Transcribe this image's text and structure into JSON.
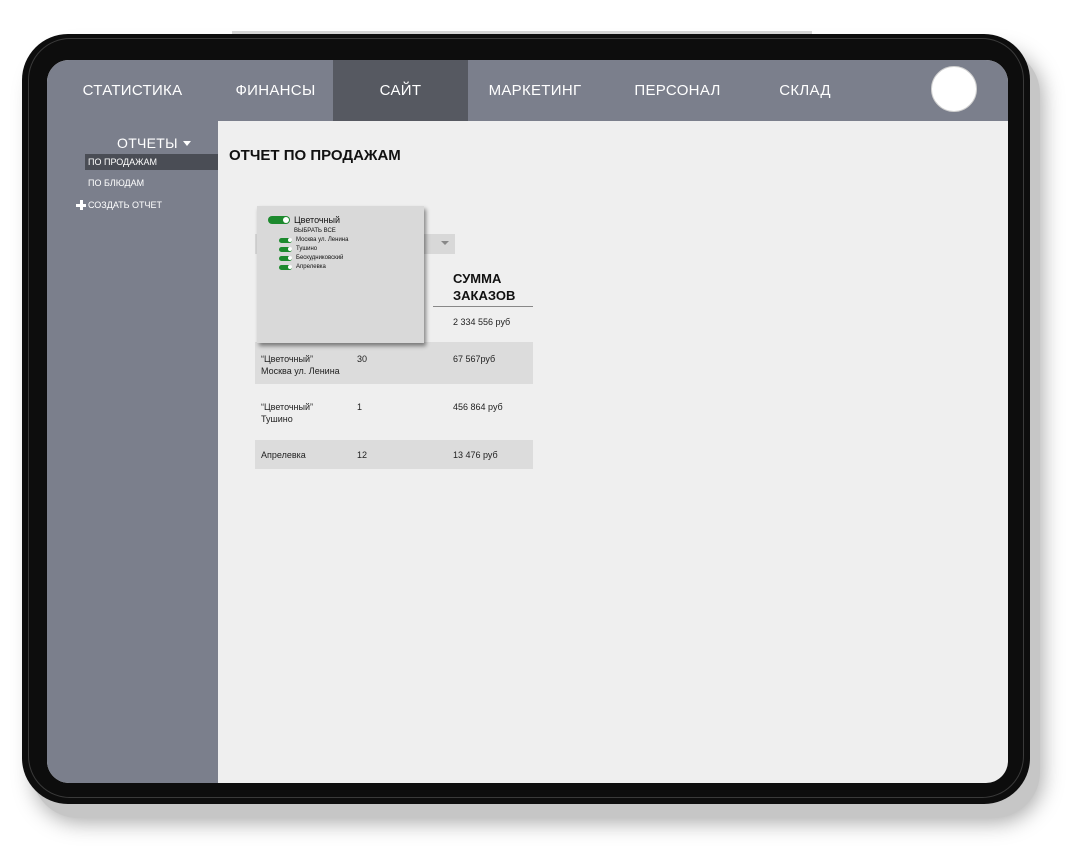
{
  "nav": {
    "items": [
      {
        "label": "СТАТИСТИКА",
        "active": false
      },
      {
        "label": "ФИНАНСЫ",
        "active": false
      },
      {
        "label": "САЙТ",
        "active": true
      },
      {
        "label": "МАРКЕТИНГ",
        "active": false
      },
      {
        "label": "ПЕРСОНАЛ",
        "active": false
      },
      {
        "label": "СКЛАД",
        "active": false
      }
    ]
  },
  "sidebar": {
    "heading": "ОТЧЕТЫ",
    "items": [
      {
        "label": "ПО ПРОДАЖАМ",
        "selected": true
      },
      {
        "label": "ПО БЛЮДАМ",
        "selected": false
      }
    ],
    "create_label": "СОЗДАТЬ ОТЧЕТ"
  },
  "main": {
    "title": "ОТЧЕТ ПО ПРОДАЖАМ"
  },
  "filter_popup": {
    "group_label": "Цветочный",
    "select_all": "ВЫБРАТЬ ВСЕ",
    "options": [
      "Москва ул. Ленина",
      "Тушино",
      "Бескудниковский",
      "Апрелевка"
    ]
  },
  "table": {
    "sum_header": "СУММА ЗАКАЗОВ",
    "sum_header_line1": "СУММА",
    "sum_header_line2": "ЗАКАЗОВ",
    "total": "2 334 556 руб",
    "rows": [
      {
        "name_line1": "“Цветочный”",
        "name_line2": "Москва ул. Ленина",
        "count": "30",
        "sum": "67 567руб"
      },
      {
        "name_line1": "“Цветочный”",
        "name_line2": "Тушино",
        "count": "1",
        "sum": "456 864 руб"
      },
      {
        "name_line1": "Апрелевка",
        "name_line2": "",
        "count": "12",
        "sum": "13 476 руб"
      }
    ]
  },
  "colors": {
    "nav_bg": "#7b7f8c",
    "nav_active": "#565961",
    "toggle_on": "#1d8a2e",
    "screen_bg": "#efefef"
  }
}
